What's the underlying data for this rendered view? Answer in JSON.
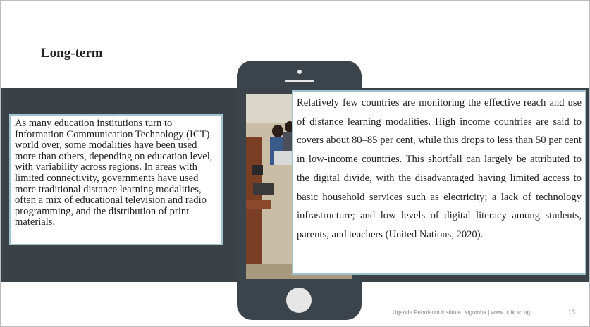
{
  "slide": {
    "title": "Long-term",
    "left_text": "As many education institutions turn to Information Communication Technology (ICT) world over, some modalities have been used more than others, depending on education level, with variability across regions. In areas with limited connectivity, governments have used more traditional distance learning modalities, often a mix of educational television and radio programming, and the distribution of print materials.",
    "right_text": "Relatively few countries are monitoring the effective reach and use of distance learning modalities. High income countries are said to covers about 80–85 per cent, while this drops to less than 50 per cent in low-income countries. This shortfall can largely be attributed to the digital divide, with the disadvantaged having limited access to basic household services such as electricity; a lack of technology infrastructure; and low levels of digital literacy among students, parents, and teachers (United Nations, 2020).",
    "footer": "Uganda Petroleum Institute, Kigumba | www.upik.ac.ug",
    "page_number": "13"
  },
  "colors": {
    "band": "#3a4247",
    "phone": "#3b444a",
    "box_border": "#9fc2cf"
  },
  "icons": {
    "phone": "smartphone-graphic",
    "photo": "classroom-photo"
  }
}
